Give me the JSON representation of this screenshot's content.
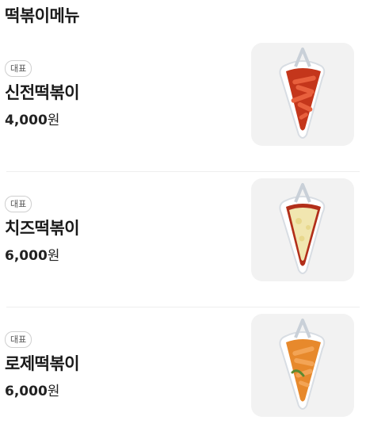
{
  "section": {
    "title": "떡볶이메뉴"
  },
  "menu_items": [
    {
      "badge": "대표",
      "name": "신전떡볶이",
      "price": "4,000",
      "currency": "원",
      "image_icon": "tteokbokki-red-sauce-icon",
      "fill_color": "#c4361b"
    },
    {
      "badge": "대표",
      "name": "치즈떡볶이",
      "price": "6,000",
      "currency": "원",
      "image_icon": "tteokbokki-cheese-icon",
      "fill_color": "#f1e6b0"
    },
    {
      "badge": "대표",
      "name": "로제떡볶이",
      "price": "6,000",
      "currency": "원",
      "image_icon": "tteokbokki-rose-sauce-icon",
      "fill_color": "#e7892c"
    }
  ]
}
